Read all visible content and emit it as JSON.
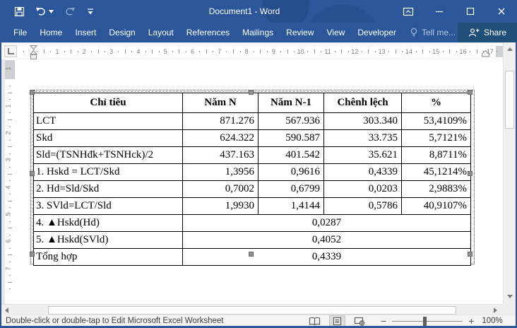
{
  "colors": {
    "accent": "#2b579a",
    "share_panel": "#1f4e79",
    "status_bottom": "#2b579a"
  },
  "titlebar": {
    "title": "Document1 - Word",
    "qat_icons": [
      "save-icon",
      "undo-icon",
      "redo-icon",
      "customize-quick-access-icon"
    ],
    "window_icons": [
      "ribbon-display-options-icon",
      "minimize-icon",
      "maximize-icon",
      "close-icon"
    ]
  },
  "ribbon": {
    "tabs": [
      "File",
      "Home",
      "Insert",
      "Design",
      "Layout",
      "References",
      "Mailings",
      "Review",
      "View",
      "Developer"
    ],
    "tell_me": "Tell me...",
    "share": "Share"
  },
  "ruler": {
    "horizontal_numbers": [
      1,
      2,
      3,
      4,
      5,
      6,
      7,
      8,
      9,
      10,
      11,
      12,
      13,
      14,
      15,
      16,
      17
    ],
    "vertical_numbers": [
      1,
      2,
      3,
      4,
      5,
      6,
      7
    ],
    "vertical_margin_number": "1"
  },
  "embedded_sheet": {
    "headers": [
      "Chỉ tiêu",
      "Năm N",
      "Năm N-1",
      "Chênh lệch",
      "%"
    ],
    "rows": [
      [
        "LCT",
        "871.276",
        "567.936",
        "303.340",
        "53,4109%"
      ],
      [
        "Skd",
        "624.322",
        "590.587",
        "33.735",
        "5,7121%"
      ],
      [
        "Sld=(TSNHđk+TSNHck)/2",
        "437.163",
        "401.542",
        "35.621",
        "8,8711%"
      ],
      [
        "1. Hskd = LCT/Skd",
        "1,3956",
        "0,9616",
        "0,4339",
        "45,1214%"
      ],
      [
        "2. Hd=Sld/Skd",
        "0,7002",
        "0,6799",
        "0,0203",
        "2,9883%"
      ],
      [
        "3. SVld=LCT/Sld",
        "1,9930",
        "1,4144",
        "0,5786",
        "40,9107%"
      ]
    ],
    "merged_rows": [
      {
        "label": "4. ▲Hskd(Hd)",
        "value": "0,0287"
      },
      {
        "label": "5. ▲Hskd(SVld)",
        "value": "0,4052"
      },
      {
        "label": "Tổng hợp",
        "value": "0,4339"
      }
    ]
  },
  "status_bar": {
    "hint": "Double-click or double-tap to Edit Microsoft Excel Worksheet",
    "view_icons": [
      "read-mode-icon",
      "print-layout-icon",
      "web-layout-icon"
    ],
    "active_view": "print-layout",
    "zoom_out": "−",
    "zoom_in": "+",
    "zoom_level": "100%"
  }
}
